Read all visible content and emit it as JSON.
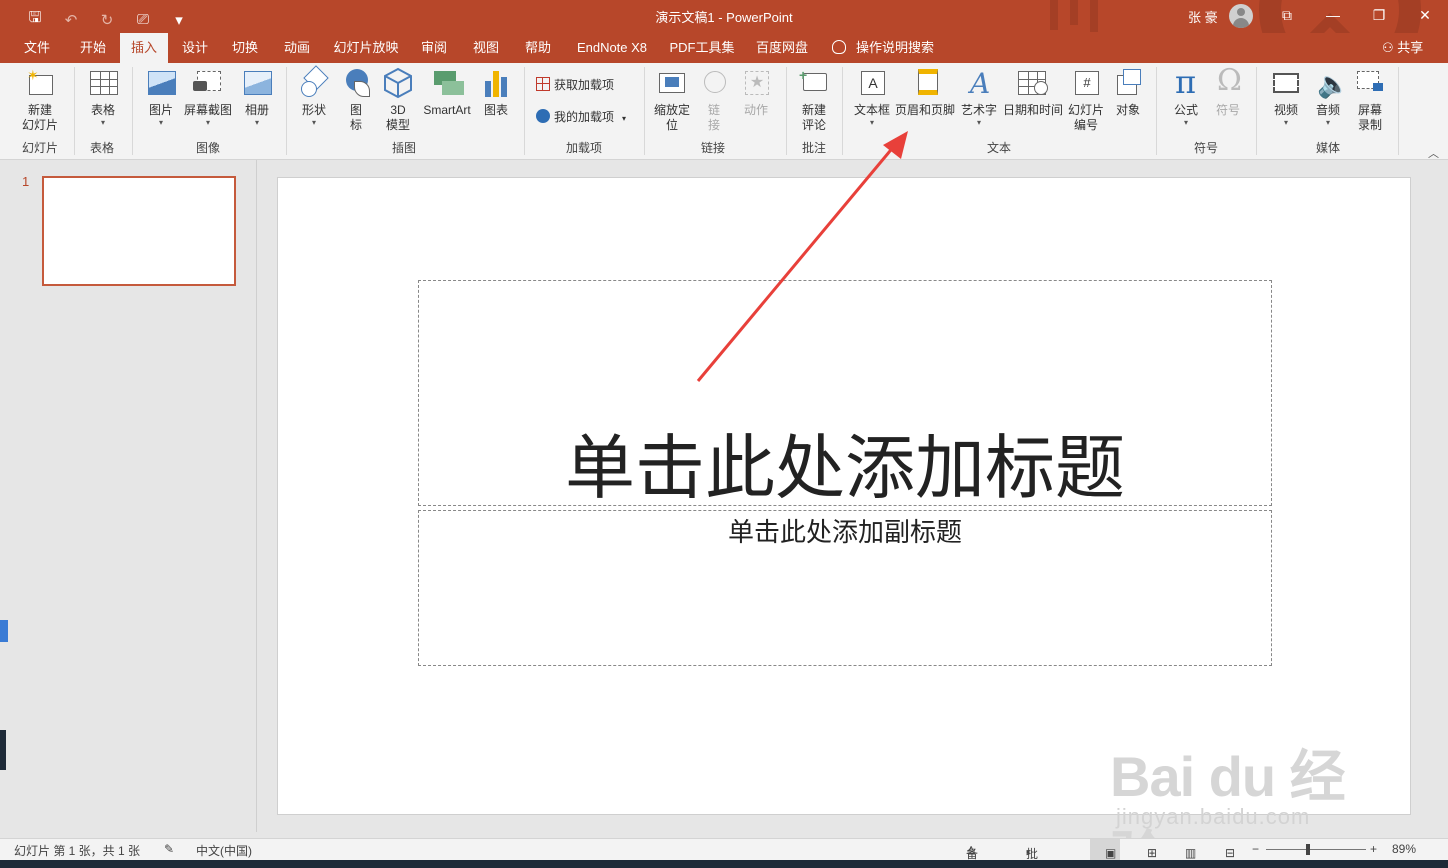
{
  "titlebar": {
    "title": "演示文稿1  -  PowerPoint",
    "user": "张 豪",
    "qat": {
      "save": "🖫",
      "undo": "↶",
      "redo": "↻",
      "present": "⎚",
      "more": "▾"
    },
    "min": "—",
    "restore": "❐",
    "close": "✕",
    "ribbon_opts": "⧉"
  },
  "tabs": [
    "文件",
    "开始",
    "插入",
    "设计",
    "切换",
    "动画",
    "幻灯片放映",
    "审阅",
    "视图",
    "帮助",
    "EndNote X8",
    "PDF工具集",
    "百度网盘",
    "操作说明搜索"
  ],
  "share": "共享",
  "ribbon": {
    "new_slide": "新建\n幻灯片",
    "table": "表格",
    "picture": "图片",
    "screenshot": "屏幕截图",
    "album": "相册",
    "shapes": "形状",
    "icons": "图\n标",
    "model3d": "3D\n模型",
    "smartart": "SmartArt",
    "chart": "图表",
    "get_addins": "获取加载项",
    "my_addins": "我的加载项",
    "zoom": "缩放定\n位",
    "link": "链\n接",
    "action": "动作",
    "comment": "新建\n评论",
    "textbox": "文本框",
    "header_footer": "页眉和页脚",
    "wordart": "艺术字",
    "datetime": "日期和时间",
    "slide_number": "幻灯片\n编号",
    "object": "对象",
    "equation": "公式",
    "symbol": "符号",
    "video": "视频",
    "audio": "音频",
    "screen_record": "屏幕\n录制",
    "groups": {
      "slides": "幻灯片",
      "tables": "表格",
      "images": "图像",
      "illustrations": "插图",
      "addins": "加载项",
      "links": "链接",
      "comments": "批注",
      "text": "文本",
      "symbols": "符号",
      "media": "媒体"
    }
  },
  "slides_pane": {
    "number": "1"
  },
  "slide": {
    "title_placeholder": "单击此处添加标题",
    "subtitle_placeholder": "单击此处添加副标题"
  },
  "statusbar": {
    "slide_info": "幻灯片 第 1 张，共 1 张",
    "language": "中文(中国)",
    "notes": "备注",
    "comments": "批注",
    "zoom": "89%",
    "minus": "−",
    "plus": "+"
  },
  "watermark": {
    "logo": "Bai du 经验",
    "url": "jingyan.baidu.com"
  },
  "colors": {
    "accent": "#b7472a",
    "arrow": "#e8403a"
  }
}
